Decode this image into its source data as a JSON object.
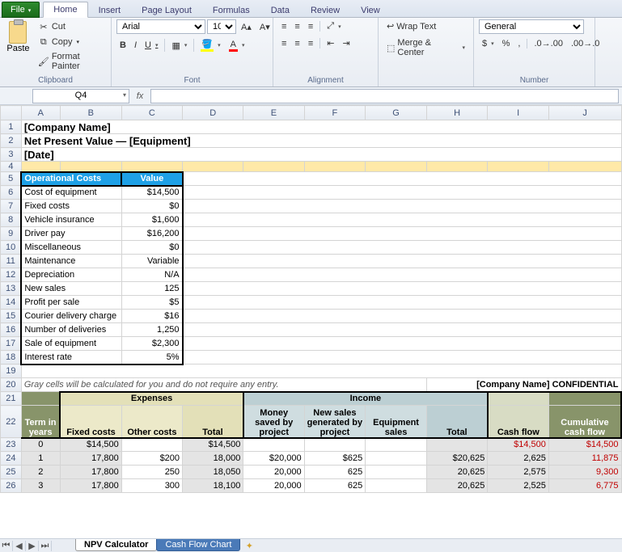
{
  "tabs": {
    "file": "File",
    "home": "Home",
    "insert": "Insert",
    "pagelayout": "Page Layout",
    "formulas": "Formulas",
    "data": "Data",
    "review": "Review",
    "view": "View"
  },
  "clipboard": {
    "paste": "Paste",
    "cut": "Cut",
    "copy": "Copy",
    "format_painter": "Format Painter",
    "title": "Clipboard"
  },
  "font": {
    "name": "Arial",
    "size": "10",
    "title": "Font"
  },
  "alignment": {
    "wrap": "Wrap Text",
    "merge": "Merge & Center",
    "title": "Alignment"
  },
  "number": {
    "format": "General",
    "title": "Number"
  },
  "namebox": "Q4",
  "cols": [
    "A",
    "B",
    "C",
    "D",
    "E",
    "F",
    "G",
    "H",
    "I",
    "J"
  ],
  "r1": "[Company Name]",
  "r2": "Net Present Value — [Equipment]",
  "r3": "[Date]",
  "opcosts_hdr": {
    "a": "Operational Costs",
    "b": "Value"
  },
  "op": [
    {
      "n": "Cost of equipment",
      "v": "$14,500"
    },
    {
      "n": "Fixed costs",
      "v": "$0"
    },
    {
      "n": "Vehicle insurance",
      "v": "$1,600"
    },
    {
      "n": "Driver pay",
      "v": "$16,200"
    },
    {
      "n": "Miscellaneous",
      "v": "$0"
    },
    {
      "n": "Maintenance",
      "v": "Variable"
    },
    {
      "n": "Depreciation",
      "v": "N/A"
    },
    {
      "n": "New sales",
      "v": "125"
    },
    {
      "n": "Profit per sale",
      "v": "$5"
    },
    {
      "n": "Courier delivery charge",
      "v": "$16"
    },
    {
      "n": "Number of deliveries",
      "v": "1,250"
    },
    {
      "n": "Sale of equipment",
      "v": "$2,300"
    },
    {
      "n": "Interest rate",
      "v": "5%"
    }
  ],
  "note": "Gray cells will be calculated for you and do not require any entry.",
  "conf": "[Company Name] CONFIDENTIAL",
  "sect": {
    "exp": "Expenses",
    "inc": "Income"
  },
  "h22": {
    "a": "Term in years",
    "b": "Fixed costs",
    "c": "Other costs",
    "d": "Total",
    "e": "Money saved by project",
    "f": "New sales generated by project",
    "g": "Equipment sales",
    "h": "Total",
    "i": "Cash flow",
    "j": "Cumulative cash flow"
  },
  "rows": [
    {
      "a": "0",
      "b": "$14,500",
      "c": "",
      "d": "$14,500",
      "e": "",
      "f": "",
      "g": "",
      "h": "",
      "i": "$14,500",
      "j": "$14,500",
      "ired": true,
      "jred": true
    },
    {
      "a": "1",
      "b": "17,800",
      "c": "$200",
      "d": "18,000",
      "e": "$20,000",
      "f": "$625",
      "g": "",
      "h": "$20,625",
      "i": "2,625",
      "j": "11,875",
      "jred": true
    },
    {
      "a": "2",
      "b": "17,800",
      "c": "250",
      "d": "18,050",
      "e": "20,000",
      "f": "625",
      "g": "",
      "h": "20,625",
      "i": "2,575",
      "j": "9,300",
      "jred": true
    },
    {
      "a": "3",
      "b": "17,800",
      "c": "300",
      "d": "18,100",
      "e": "20,000",
      "f": "625",
      "g": "",
      "h": "20,625",
      "i": "2,525",
      "j": "6,775",
      "jred": true
    }
  ],
  "sheets": {
    "s1": "NPV Calculator",
    "s2": "Cash Flow Chart"
  }
}
